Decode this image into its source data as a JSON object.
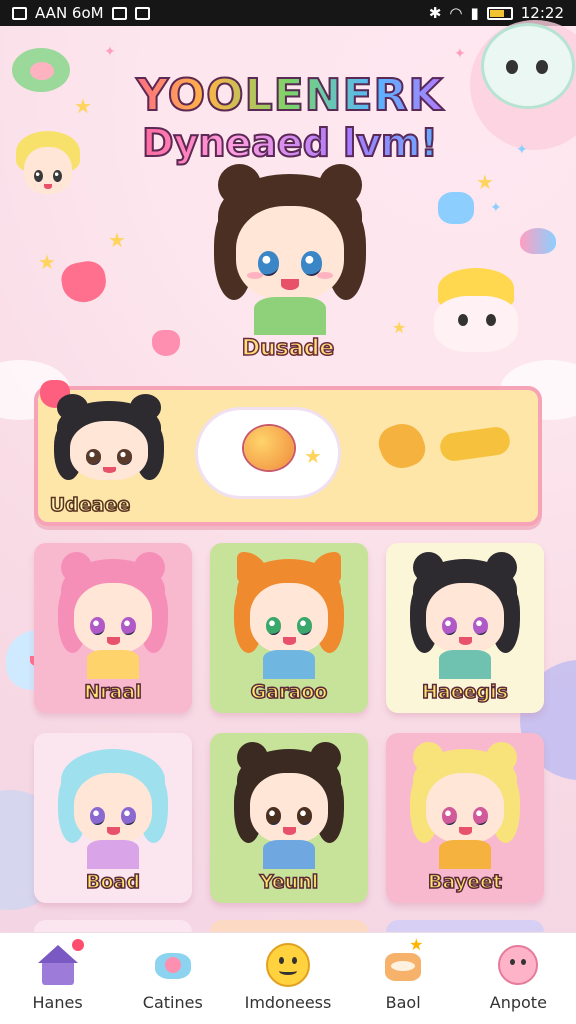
{
  "status_bar": {
    "left_text": "AAN 6oM",
    "time": "12:22"
  },
  "header": {
    "title_line1": "YOOLENERK",
    "title_line2": "Dyneaed lvm!"
  },
  "main_character": {
    "name": "Dusade"
  },
  "featured": {
    "character_name": "Udeaee"
  },
  "grid": {
    "cards": [
      {
        "name": "Nraal"
      },
      {
        "name": "Garaoo"
      },
      {
        "name": "Haeegis"
      },
      {
        "name": "Boad"
      },
      {
        "name": "Yeunl"
      },
      {
        "name": "Bayeet"
      }
    ]
  },
  "bottom_nav": {
    "items": [
      {
        "label": "Hanes",
        "icon": "house-icon"
      },
      {
        "label": "Catines",
        "icon": "candy-icon"
      },
      {
        "label": "Imdoneess",
        "icon": "smiley-icon"
      },
      {
        "label": "Baol",
        "icon": "puppy-icon"
      },
      {
        "label": "Anpote",
        "icon": "face-icon"
      }
    ]
  },
  "colors": {
    "background": "#fbe3ea",
    "featured_bg": "#fde6a8",
    "featured_border": "#f6a3b8",
    "accent_pink": "#ff5f8f",
    "nav_bg": "#ffffff"
  }
}
